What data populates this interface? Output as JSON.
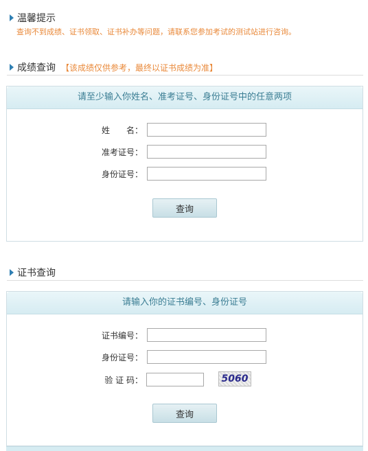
{
  "notice": {
    "title": "温馨提示",
    "text": "查询不到成绩、证书领取、证书补办等问题，请联系您参加考试的测试站进行咨询。"
  },
  "score_query": {
    "title": "成绩查询",
    "tip": "【该成绩仅供参考，最终以证书成绩为准】",
    "panel_title": "请至少输入你姓名、准考证号、身份证号中的任意两项",
    "name_label": "姓　　名：",
    "name_value": "",
    "ticket_label": "准考证号：",
    "ticket_value": "",
    "id_label": "身份证号：",
    "id_value": "",
    "button": "查询"
  },
  "cert_query": {
    "title": "证书查询",
    "panel_title": "请输入你的证书编号、身份证号",
    "cert_label": "证书编号：",
    "cert_value": "",
    "id_label": "身份证号：",
    "id_value": "",
    "code_label": "验 证 码：",
    "code_value": "",
    "captcha_text": "5060",
    "button": "查询"
  },
  "colors": {
    "accent": "#2f7fb3",
    "notice": "#e9893a",
    "panel_head_text": "#3a7d93"
  }
}
